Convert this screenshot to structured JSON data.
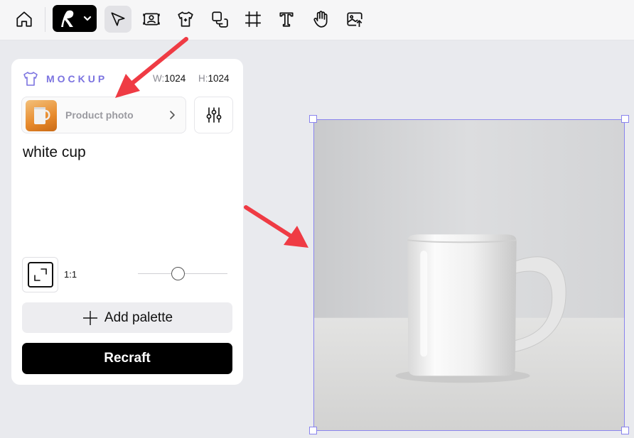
{
  "toolbar": {
    "items": [
      {
        "name": "home",
        "icon": "home-icon"
      },
      {
        "name": "app-menu",
        "icon": "recraft-logo-icon"
      },
      {
        "name": "select",
        "icon": "pointer-icon",
        "active": true
      },
      {
        "name": "image-set",
        "icon": "image-frame-icon"
      },
      {
        "name": "mockup",
        "icon": "tshirt-icon"
      },
      {
        "name": "layers",
        "icon": "layers-icon"
      },
      {
        "name": "frame",
        "icon": "frame-icon"
      },
      {
        "name": "text",
        "icon": "text-icon"
      },
      {
        "name": "hand",
        "icon": "hand-icon"
      },
      {
        "name": "upload",
        "icon": "image-upload-icon"
      }
    ]
  },
  "panel": {
    "title": "MOCKUP",
    "width_label": "W:",
    "width_value": "1024",
    "height_label": "H:",
    "height_value": "1024",
    "style_label": "Product photo",
    "prompt": "white cup",
    "ratio_label": "1:1",
    "slider_fraction": 0.45,
    "add_palette_label": "Add palette",
    "generate_label": "Recraft"
  },
  "colors": {
    "accent": "#7b73e0",
    "selection": "#8a84ee",
    "annotation_arrow": "#ef3b44",
    "primary_button": "#000000"
  }
}
